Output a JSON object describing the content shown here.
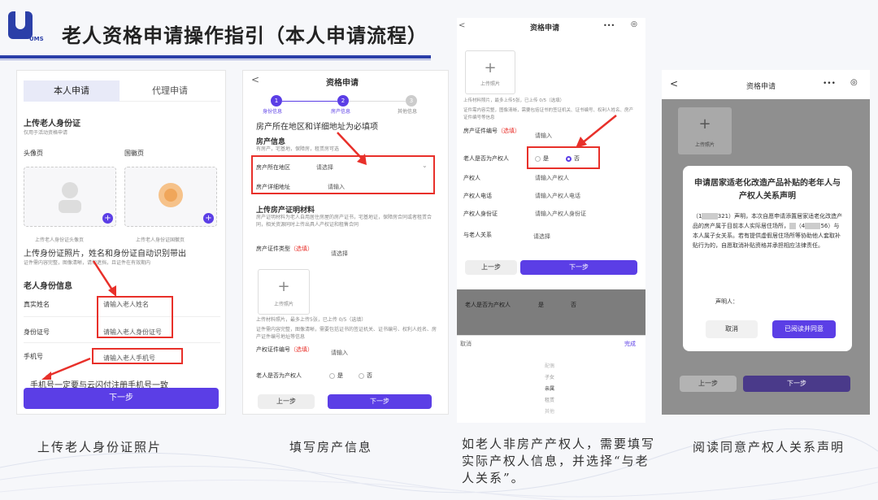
{
  "header": {
    "title": "老人资格申请操作指引（本人申请流程）",
    "logo_text": "UMS"
  },
  "card1": {
    "tab_self": "本人申请",
    "tab_agent": "代理申请",
    "section_title": "上传老人身份证",
    "section_sub": "仅用于活动资格申请",
    "front_label": "头像页",
    "back_label": "国徽页",
    "front_caption": "上传老人身份证头像页",
    "back_caption": "上传老人身份证国徽页",
    "note1": "上传身份证照片，姓名和身份证自动识别带出",
    "note1_sub": "证件需内容完整，图像清晰，请勿遮挡，且证件在有效期内",
    "info_title": "老人身份信息",
    "name_label": "真实姓名",
    "name_ph": "请输入老人姓名",
    "id_label": "身份证号",
    "id_ph": "请输入老人身份证号",
    "phone_label": "手机号",
    "phone_ph": "请输入老人手机号",
    "note2": "手机号一定要与云闪付注册手机号一致",
    "next": "下一步"
  },
  "card2": {
    "title": "资格申请",
    "back": "<",
    "steps": [
      "身份信息",
      "房产信息",
      "其他信息"
    ],
    "step_nums": [
      "1",
      "2",
      "3"
    ],
    "red_note": "房产所在地区和详细地址为必填项",
    "prop_title": "房产信息",
    "prop_sub": "有房产，宅基地，保障房，租赁房可选",
    "area_label": "房产所在地区",
    "area_ph": "请选择",
    "addr_label": "房产详细地址",
    "addr_ph": "请输入",
    "cert_title": "上传房产证明材料",
    "cert_sub": "房产证明材料为老人自用居住房屋的房产证书，宅基地证，保障房合同或者租赁合同，相关资源同时上传出具人产权证和租售合同",
    "type_label": "房产证件类型",
    "type_opt": "（选填）",
    "type_ph": "请选择",
    "upload_text": "上传照片",
    "plus": "+",
    "upload_limit": "上传材料照片，最多上传5张，已上传 0/5（选填）",
    "upload_note": "证件需内容完整，图像清晰，需要包括证书的签证机关、证书编号、权利人姓名、房产证件编号地址等信息",
    "certno_label": "产权证件编号",
    "certno_opt": "（选填）",
    "certno_ph": "请输入",
    "owner_q": "老人是否为产权人",
    "yes": "是",
    "no": "否",
    "prev": "上一步",
    "next": "下一步"
  },
  "card3": {
    "title": "资格申请",
    "menu": "•••",
    "back": "<",
    "upload_text": "上传照片",
    "plus": "+",
    "upload_limit": "上传材料照片，最多上传5张，已上传 0/5（选填）",
    "upload_note": "证件需内容完整，图像清晰，需要包括证书的签证机关、证书编号、权利人姓名、房产证件编号等信息",
    "certno_label": "房产证件编号",
    "certno_opt": "（选填）",
    "certno_ph": "请输入",
    "owner_q": "老人是否为产权人",
    "yes": "是",
    "no": "否",
    "owner_label": "产权人",
    "owner_ph": "请输入产权人",
    "phone_label": "产权人电话",
    "phone_ph": "请输入产权人电话",
    "oid_label": "产权人身份证",
    "oid_ph": "请输入产权人身份证",
    "rel_label": "与老人关系",
    "rel_ph": "请选择",
    "prev": "上一步",
    "next": "下一步",
    "picker_cancel": "取消",
    "picker_ok": "完成",
    "picker_options": [
      "配偶",
      "子女",
      "亲属",
      "租赁",
      "其他"
    ]
  },
  "card4": {
    "title": "资格申请",
    "menu": "•••",
    "back": "<",
    "upload_text": "上传照片",
    "plus": "+",
    "dlg_title": "申请居家适老化改造产品补贴的老年人与产权人关系声明",
    "dlg_body1": "（1",
    "dlg_body1b": "321）声明，本次自愿申请添置居家适老化改造产品的房产属于目前本人实际居住场所，",
    "dlg_body2": "（4",
    "dlg_body2b": "56）与本人属子女关系。若有提供虚假居住场所等协助他人套取补贴行为的，自愿取消补贴资格并承担相应法律责任。",
    "signer": "声明人：",
    "cancel": "取消",
    "agree": "已阅读并同意",
    "prev": "上一步",
    "next": "下一步"
  },
  "captions": {
    "c1": "上传老人身份证照片",
    "c2": "填写房产信息",
    "c3": "如老人非房产产权人，需要填写实际产权人信息，并选择“与老人关系”。",
    "c4": "阅读同意产权人关系声明"
  },
  "colors": {
    "brand": "#2b3fa8",
    "accent": "#5b3ee6",
    "annotation": "#e8302a"
  }
}
